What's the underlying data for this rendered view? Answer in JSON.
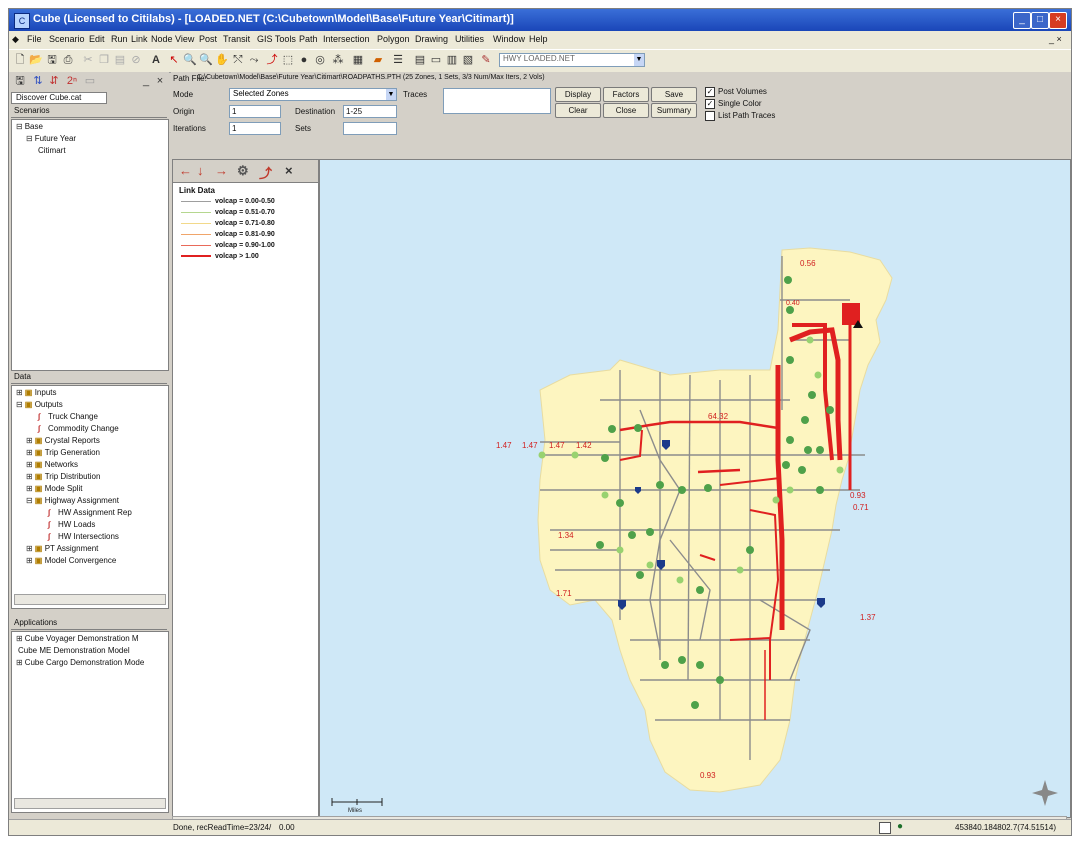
{
  "window": {
    "title": "Cube (Licensed to Citilabs) - [LOADED.NET (C:\\Cubetown\\Model\\Base\\Future Year\\Citimart)]"
  },
  "menu": [
    "File",
    "Scenario",
    "Edit",
    "Run",
    "Link",
    "Node",
    "View",
    "Post",
    "Transit",
    "GIS Tools",
    "Path",
    "Intersection",
    "Polygon",
    "Drawing",
    "Utilities",
    "Window",
    "Help"
  ],
  "toolbar": {
    "layer_combo": "HWY LOADED.NET"
  },
  "left": {
    "tab_label": "Discover Cube.cat",
    "scenarios_header": "Scenarios",
    "scenarios": [
      {
        "label": "Base",
        "indent": 0,
        "expander": "⊟"
      },
      {
        "label": "Future Year",
        "indent": 1,
        "expander": "⊟"
      },
      {
        "label": "Citimart",
        "indent": 2,
        "expander": ""
      }
    ],
    "data_header": "Data",
    "data_items": [
      {
        "label": "Inputs",
        "indent": 0,
        "expander": "⊞",
        "kind": "folder"
      },
      {
        "label": "Outputs",
        "indent": 0,
        "expander": "⊟",
        "kind": "folder"
      },
      {
        "label": "Truck Change",
        "indent": 2,
        "expander": "",
        "kind": "item"
      },
      {
        "label": "Commodity Change",
        "indent": 2,
        "expander": "",
        "kind": "item"
      },
      {
        "label": "Crystal Reports",
        "indent": 1,
        "expander": "⊞",
        "kind": "folder"
      },
      {
        "label": "Trip Generation",
        "indent": 1,
        "expander": "⊞",
        "kind": "folder"
      },
      {
        "label": "Networks",
        "indent": 1,
        "expander": "⊞",
        "kind": "folder"
      },
      {
        "label": "Trip Distribution",
        "indent": 1,
        "expander": "⊞",
        "kind": "folder"
      },
      {
        "label": "Mode Split",
        "indent": 1,
        "expander": "⊞",
        "kind": "folder"
      },
      {
        "label": "Highway Assignment",
        "indent": 1,
        "expander": "⊟",
        "kind": "folder"
      },
      {
        "label": "HW Assignment Rep",
        "indent": 3,
        "expander": "",
        "kind": "item"
      },
      {
        "label": "HW Loads",
        "indent": 3,
        "expander": "",
        "kind": "item"
      },
      {
        "label": "HW Intersections",
        "indent": 3,
        "expander": "",
        "kind": "item"
      },
      {
        "label": "PT Assignment",
        "indent": 1,
        "expander": "⊞",
        "kind": "folder"
      },
      {
        "label": "Model Convergence",
        "indent": 1,
        "expander": "⊞",
        "kind": "folder"
      }
    ],
    "apps_header": "Applications",
    "apps": [
      {
        "label": "Cube Voyager Demonstration M",
        "expander": "⊞"
      },
      {
        "label": "Cube ME Demonstration Model",
        "expander": ""
      },
      {
        "label": "Cube Cargo Demonstration Mode",
        "expander": "⊞"
      }
    ]
  },
  "path": {
    "file_label": "Path File:",
    "file_value": "C:\\Cubetown\\Model\\Base\\Future Year\\Citimart\\ROADPATHS.PTH (25 Zones, 1 Sets, 3/3 Num/Max Iters, 2 Vols)",
    "mode_label": "Mode",
    "mode_value": "Selected Zones",
    "traces_label": "Traces",
    "origin_label": "Origin",
    "origin_value": "1",
    "destination_label": "Destination",
    "destination_value": "1-25",
    "iterations_label": "Iterations",
    "iterations_value": "1",
    "sets_label": "Sets",
    "sets_value": "",
    "buttons": [
      "Display",
      "Factors",
      "Save",
      "Clear",
      "Close",
      "Summary"
    ],
    "checks": [
      {
        "label": "Post Volumes",
        "checked": true
      },
      {
        "label": "Single Color",
        "checked": true
      },
      {
        "label": "List Path Traces",
        "checked": false
      }
    ]
  },
  "legend": {
    "title": "Link Data",
    "rows": [
      {
        "label": "volcap = 0.00-0.50",
        "color": "#9e9e9e",
        "width": 1
      },
      {
        "label": "volcap = 0.51-0.70",
        "color": "#b5d78f",
        "width": 1
      },
      {
        "label": "volcap = 0.71-0.80",
        "color": "#f2d98a",
        "width": 1
      },
      {
        "label": "volcap = 0.81-0.90",
        "color": "#f0a56a",
        "width": 1
      },
      {
        "label": "volcap = 0.90-1.00",
        "color": "#e96a5a",
        "width": 1
      },
      {
        "label": "volcap > 1.00",
        "color": "#e02020",
        "width": 2
      }
    ]
  },
  "map": {
    "labels": [
      "0.56",
      "0.40",
      "64.32",
      "1.47",
      "1.47",
      "1.47",
      "1.42",
      "0.93",
      "0.71",
      "1.34",
      "1.71",
      "1.37",
      "0.93"
    ],
    "scale_label": "Miles",
    "land_color": "#fdf5c0",
    "water_color": "#cfe8f7",
    "congested_color": "#e02020"
  },
  "status": {
    "left": "Done, recReadTime=23/24/",
    "mid": "0.00",
    "right": "453840.184802.7(74.51514)"
  }
}
